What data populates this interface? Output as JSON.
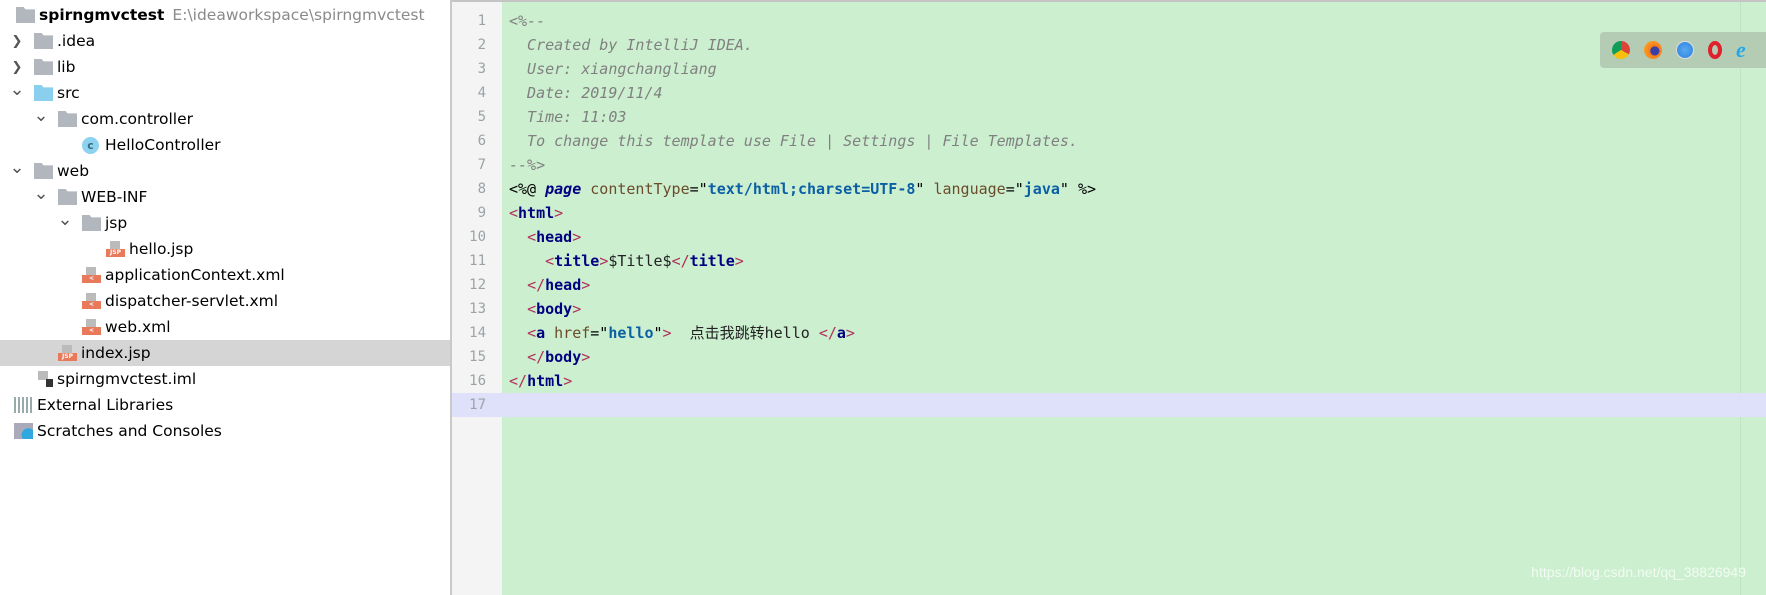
{
  "project_tree": {
    "root": {
      "name": "spirngmvctest",
      "path": "E:\\ideaworkspace\\spirngmvctest"
    },
    "items": [
      {
        "label": ".idea",
        "depth": 1,
        "chevron": "right",
        "icon": "folder-icon"
      },
      {
        "label": "lib",
        "depth": 1,
        "chevron": "right",
        "icon": "folder-icon"
      },
      {
        "label": "src",
        "depth": 1,
        "chevron": "down",
        "icon": "source-folder-icon"
      },
      {
        "label": "com.controller",
        "depth": 2,
        "chevron": "down",
        "icon": "package-icon"
      },
      {
        "label": "HelloController",
        "depth": 3,
        "chevron": "",
        "icon": "class-icon"
      },
      {
        "label": "web",
        "depth": 1,
        "chevron": "down",
        "icon": "web-folder-icon"
      },
      {
        "label": "WEB-INF",
        "depth": 2,
        "chevron": "down",
        "icon": "folder-icon"
      },
      {
        "label": "jsp",
        "depth": 3,
        "chevron": "down",
        "icon": "folder-icon"
      },
      {
        "label": "hello.jsp",
        "depth": 4,
        "chevron": "",
        "icon": "jsp-file-icon"
      },
      {
        "label": "applicationContext.xml",
        "depth": 3,
        "chevron": "",
        "icon": "spring-xml-icon"
      },
      {
        "label": "dispatcher-servlet.xml",
        "depth": 3,
        "chevron": "",
        "icon": "spring-xml-icon"
      },
      {
        "label": "web.xml",
        "depth": 3,
        "chevron": "",
        "icon": "web-xml-icon"
      },
      {
        "label": "index.jsp",
        "depth": 2,
        "chevron": "",
        "icon": "jsp-file-icon",
        "selected": true
      },
      {
        "label": "spirngmvctest.iml",
        "depth": 1,
        "chevron": "",
        "icon": "iml-file-icon"
      },
      {
        "label": "External Libraries",
        "depth": 0,
        "chevron": "",
        "icon": "libraries-icon"
      },
      {
        "label": "Scratches and Consoles",
        "depth": 0,
        "chevron": "",
        "icon": "scratches-icon"
      }
    ]
  },
  "editor": {
    "current_line": 17,
    "lines": [
      [
        [
          "c",
          "<%--"
        ]
      ],
      [
        [
          "c",
          "  Created by IntelliJ IDEA."
        ]
      ],
      [
        [
          "c",
          "  User: xiangchangliang"
        ]
      ],
      [
        [
          "c",
          "  Date: 2019/11/4"
        ]
      ],
      [
        [
          "c",
          "  Time: 11:03"
        ]
      ],
      [
        [
          "c",
          "  To change this template use File | Settings | File Templates."
        ]
      ],
      [
        [
          "c",
          "--%>"
        ]
      ],
      [
        [
          "d",
          "<%@ "
        ],
        [
          "k",
          "page"
        ],
        [
          "a",
          " contentType"
        ],
        [
          "d",
          "=\""
        ],
        [
          "s",
          "text/html;charset=UTF-8"
        ],
        [
          "d",
          "\""
        ],
        [
          "a",
          " language"
        ],
        [
          "d",
          "=\""
        ],
        [
          "s",
          "java"
        ],
        [
          "d",
          "\" %>"
        ]
      ],
      [
        [
          "g",
          "<"
        ],
        [
          "n",
          "html"
        ],
        [
          "g",
          ">"
        ]
      ],
      [
        [
          "t",
          "  "
        ],
        [
          "g",
          "<"
        ],
        [
          "n",
          "head"
        ],
        [
          "g",
          ">"
        ]
      ],
      [
        [
          "t",
          "    "
        ],
        [
          "g",
          "<"
        ],
        [
          "n",
          "title"
        ],
        [
          "g",
          ">"
        ],
        [
          "t",
          "$Title$"
        ],
        [
          "g",
          "</"
        ],
        [
          "n",
          "title"
        ],
        [
          "g",
          ">"
        ]
      ],
      [
        [
          "t",
          "  "
        ],
        [
          "g",
          "</"
        ],
        [
          "n",
          "head"
        ],
        [
          "g",
          ">"
        ]
      ],
      [
        [
          "t",
          "  "
        ],
        [
          "g",
          "<"
        ],
        [
          "n",
          "body"
        ],
        [
          "g",
          ">"
        ]
      ],
      [
        [
          "t",
          "  "
        ],
        [
          "g",
          "<"
        ],
        [
          "n",
          "a"
        ],
        [
          "a",
          " href"
        ],
        [
          "d",
          "=\""
        ],
        [
          "s",
          "hello"
        ],
        [
          "d",
          "\""
        ],
        [
          "g",
          ">"
        ],
        [
          "t",
          "  点击我跳转hello "
        ],
        [
          "g",
          "</"
        ],
        [
          "n",
          "a"
        ],
        [
          "g",
          ">"
        ]
      ],
      [
        [
          "t",
          "  "
        ],
        [
          "g",
          "</"
        ],
        [
          "n",
          "body"
        ],
        [
          "g",
          ">"
        ]
      ],
      [
        [
          "g",
          "</"
        ],
        [
          "n",
          "html"
        ],
        [
          "g",
          ">"
        ]
      ],
      []
    ]
  },
  "browser_bar": {
    "icons": [
      "chrome-icon",
      "firefox-icon",
      "safari-icon",
      "opera-icon",
      "ie-icon"
    ]
  },
  "watermark": "https://blog.csdn.net/qq_38826949"
}
